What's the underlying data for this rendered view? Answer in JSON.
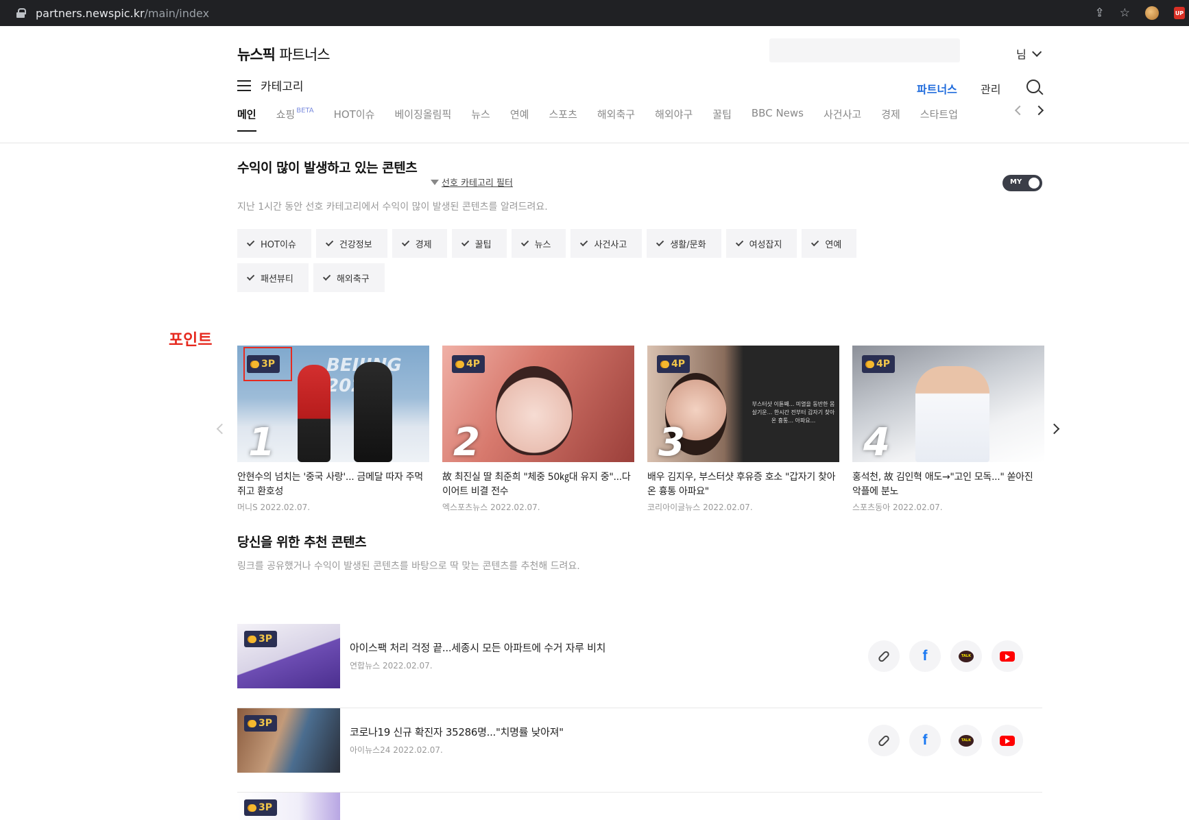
{
  "browser": {
    "url_host": "partners.newspic.kr",
    "url_path": "/main/index",
    "icons": [
      "lock-icon",
      "share-icon",
      "star-icon",
      "extension-avatar-icon",
      "extension-badge-icon"
    ],
    "badge_text": "UP"
  },
  "header": {
    "logo_bold": "뉴스픽",
    "logo_thin": "파트너스",
    "user_label": "님",
    "category_label": "카테고리",
    "partners_link": "파트너스",
    "admin_link": "관리"
  },
  "nav": {
    "items": [
      "메인",
      "쇼핑",
      "HOT이슈",
      "베이징올림픽",
      "뉴스",
      "연예",
      "스포츠",
      "해외축구",
      "해외야구",
      "꿀팁",
      "BBC News",
      "사건사고",
      "경제",
      "스타트업"
    ],
    "beta_label": "BETA",
    "active_index": 0
  },
  "trending": {
    "title": "수익이 많이 발생하고 있는 콘텐츠",
    "filter_label": "선호 카테고리 필터",
    "description": "지난 1시간 동안 선호 카테고리에서 수익이 많이 발생된 콘텐츠를 알려드려요.",
    "toggle_label": "MY",
    "chips": [
      "HOT이슈",
      "건강정보",
      "경제",
      "꿀팁",
      "뉴스",
      "사건사고",
      "생활/문화",
      "여성잡지",
      "연예",
      "패션뷰티",
      "해외축구"
    ],
    "point_annotation": "포인트",
    "cards": [
      {
        "rank": "1",
        "points": "3P",
        "banner": "BEIJING 2022",
        "title": "안현수의 넘치는 '중국 사랑'... 금메달 따자 주먹 쥐고 환호성",
        "source": "머니S",
        "date": "2022.02.07."
      },
      {
        "rank": "2",
        "points": "4P",
        "title": "故 최진실 딸 최준희 \"체중 50㎏대 유지 중\"...다이어트 비결 전수",
        "source": "엑스포츠뉴스",
        "date": "2022.02.07."
      },
      {
        "rank": "3",
        "points": "4P",
        "caption": "부스터샷 이튿째... 미열을 동반한 몸살기운... 한시간 전부터 갑자기 찾아온 흉통... 아파요...",
        "title": "배우 김지우, 부스터샷 후유증 호소 \"갑자기 찾아온 흉통 아파요\"",
        "source": "코리아이글뉴스",
        "date": "2022.02.07."
      },
      {
        "rank": "4",
        "points": "4P",
        "title": "홍석천, 故 김인혁 애도→\"고인 모독...\" 쏟아진 악플에 분노",
        "source": "스포츠동아",
        "date": "2022.02.07."
      }
    ]
  },
  "recommend": {
    "title": "당신을 위한 추천 콘텐츠",
    "description": "링크를 공유했거나 수익이 발생된 콘텐츠를 바탕으로 딱 맞는 콘텐츠를 추천해 드려요.",
    "items": [
      {
        "points": "3P",
        "title": "아이스팩 처리 걱정 끝...세종시 모든 아파트에 수거 자루 비치",
        "source": "연합뉴스",
        "date": "2022.02.07."
      },
      {
        "points": "3P",
        "title": "코로나19 신규 확진자 35286명...\"치명률 낮아져\"",
        "source": "아이뉴스24",
        "date": "2022.02.07."
      },
      {
        "points": "3P",
        "title": "",
        "source": "",
        "date": ""
      }
    ],
    "kakao_label": "TALK",
    "facebook_label": "f"
  },
  "colors": {
    "accent_blue": "#1f6bdc",
    "annotation_red": "#e62a1f",
    "badge_bg": "#2a2f52",
    "coin": "#f5b82e"
  }
}
